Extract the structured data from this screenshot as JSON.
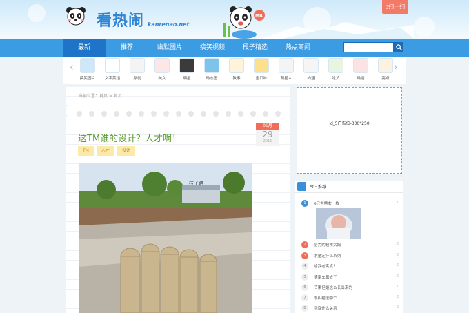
{
  "site": {
    "logo_text": "看热闹",
    "logo_sub": "kanrenao.net",
    "qr_label": "扫一扫",
    "mascot_badge": "MIL"
  },
  "nav": {
    "items": [
      "最新",
      "推荐",
      "幽默图片",
      "搞笑视频",
      "段子精选",
      "热点商闻"
    ],
    "active_index": 0,
    "search_placeholder": ""
  },
  "categories": {
    "items": [
      {
        "label": "搞笑图片",
        "icon": "picture-icon"
      },
      {
        "label": "文字笑话",
        "icon": "text-doc-icon"
      },
      {
        "label": "原创",
        "icon": "panda-icon"
      },
      {
        "label": "美女",
        "icon": "lips-icon"
      },
      {
        "label": "明星",
        "icon": "cat-mask-icon"
      },
      {
        "label": "动态图",
        "icon": "flag-icon"
      },
      {
        "label": "教事",
        "icon": "poop-icon"
      },
      {
        "label": "重口味",
        "icon": "book-icon"
      },
      {
        "label": "萌星人",
        "icon": "bunny-icon"
      },
      {
        "label": "内涵",
        "icon": "egg-icon"
      },
      {
        "label": "吃货",
        "icon": "watermelon-icon"
      },
      {
        "label": "贱话",
        "icon": "pig-icon"
      },
      {
        "label": "亮点",
        "icon": "donut-icon"
      }
    ]
  },
  "breadcrumb": "当前位置：首页 > 首页",
  "post": {
    "title": "这TM谁的设计？人才啊！",
    "month": "06月",
    "day": "29",
    "year": "2015",
    "tags": [
      "TM",
      "人才",
      "设计"
    ],
    "photo_sign": "枝子路"
  },
  "sidebar": {
    "ad_text": "id_5广告位-300*250",
    "recommend_title": "今日推荐",
    "items": [
      {
        "num": "1",
        "title": "6只大熊女一枚",
        "count": "0"
      },
      {
        "num": "2",
        "title": "给力的超市大妈",
        "count": "0"
      },
      {
        "num": "3",
        "title": "求童定什么系列",
        "count": "0"
      },
      {
        "num": "4",
        "title": "哈我老实点！",
        "count": "0"
      },
      {
        "num": "5",
        "title": "德家车飘去了",
        "count": "0"
      },
      {
        "num": "6",
        "title": "芒果但最这么长出来的",
        "count": "0"
      },
      {
        "num": "7",
        "title": "很纠结选哪个",
        "count": "0"
      },
      {
        "num": "8",
        "title": "到底什么关系",
        "count": "0"
      }
    ]
  },
  "colors": {
    "nav": "#3b9be3",
    "nav_active": "#1e74c8",
    "accent_red": "#f06e59",
    "title_green": "#5a9a2c",
    "tag_bg": "#fde9a9"
  }
}
